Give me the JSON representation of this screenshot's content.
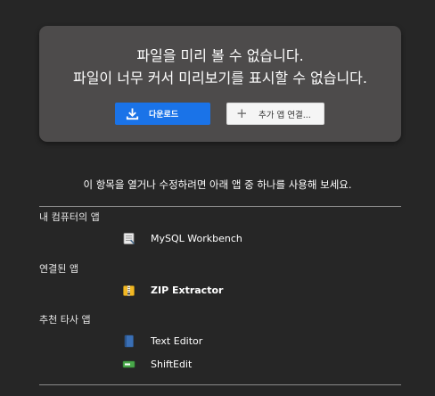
{
  "preview": {
    "message_line1": "파일을 미리 볼 수 없습니다.",
    "message_line2": "파일이 너무 커서 미리보기를 표시할 수 없습니다.",
    "download_label": "다운로드",
    "connect_label": "추가 앱 연결..."
  },
  "instruction": "이 항목을 열거나 수정하려면 아래 앱 중 하나를 사용해 보세요.",
  "sections": {
    "my_computer": {
      "heading": "내 컴퓨터의 앱",
      "apps": [
        {
          "label": "MySQL Workbench",
          "icon": "mysql-workbench-icon"
        }
      ]
    },
    "connected": {
      "heading": "연결된 앱",
      "apps": [
        {
          "label": "ZIP Extractor",
          "icon": "zip-extractor-icon"
        }
      ]
    },
    "suggested": {
      "heading": "추천 타사 앱",
      "apps": [
        {
          "label": "Text Editor",
          "icon": "text-editor-icon"
        },
        {
          "label": "ShiftEdit",
          "icon": "shiftedit-icon"
        }
      ]
    }
  },
  "colors": {
    "background": "#262626",
    "card": "#4d4b4b",
    "primary_button": "#1a73e8",
    "secondary_button": "#f5f5f5"
  }
}
